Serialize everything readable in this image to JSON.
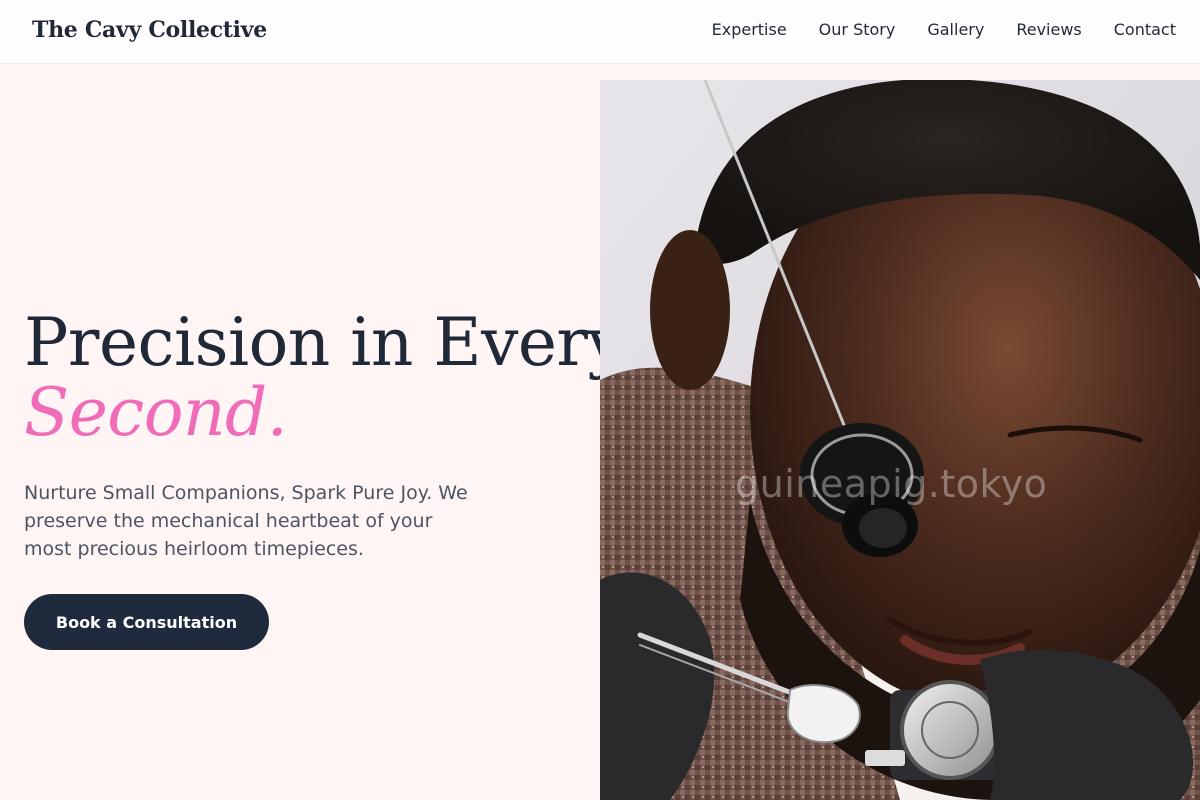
{
  "header": {
    "logo": "The Cavy Collective",
    "nav": [
      "Expertise",
      "Our Story",
      "Gallery",
      "Reviews",
      "Contact"
    ]
  },
  "hero": {
    "headline_line1": "Precision in Every",
    "headline_accent": "Second.",
    "tagline": "Nurture Small Companions, Spark Pure Joy. We preserve the mechanical heartbeat of your most precious heirloom timepieces.",
    "cta_label": "Book a Consultation",
    "image_watermark": "guineapig.tokyo",
    "image_icon": "watchmaker-photo"
  },
  "colors": {
    "page_bg": "#fff5f5",
    "text_dark": "#1f2937",
    "accent_pink": "#f06cb9",
    "button_bg": "#1f2a3d"
  }
}
